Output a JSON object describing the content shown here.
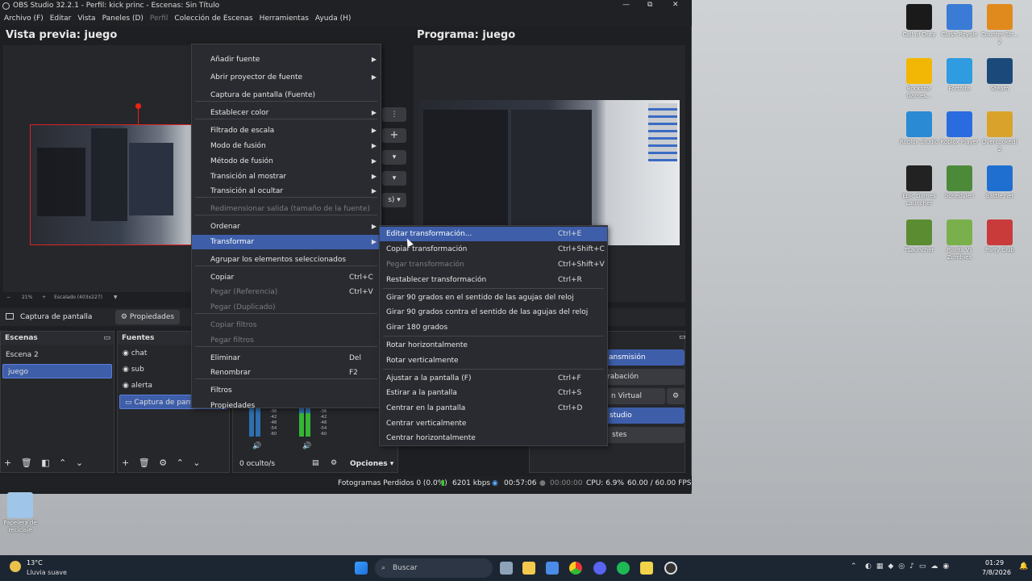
{
  "window": {
    "title": "OBS Studio 32.2.1 - Perfil: kick princ - Escenas: Sin Título",
    "minimize": "—",
    "maximize": "⧉",
    "close": "✕"
  },
  "menubar": [
    "Archivo (F)",
    "Editar",
    "Vista",
    "Paneles (D)",
    "Perfil",
    "Colección de Escenas",
    "Herramientas",
    "Ayuda (H)"
  ],
  "preview": {
    "title": "Vista previa: juego",
    "zoom": "21%",
    "scale": "Escalado (403x227)"
  },
  "program": {
    "title": "Programa: juego"
  },
  "source_toolbar": {
    "source": "Captura de pantalla",
    "properties": "Propiedades"
  },
  "scenes": {
    "title": "Escenas",
    "items": [
      "Escena 2",
      "juego"
    ]
  },
  "sources": {
    "title": "Fuentes",
    "items": [
      "chat",
      "sub",
      "alerta",
      "Captura de pantalla"
    ]
  },
  "mixer": {
    "hidden": "0 oculto/s",
    "options": "Opciones",
    "ticks": [
      "-36",
      "-42",
      "-48",
      "-54",
      "-60"
    ]
  },
  "controls": {
    "stream": "ansmisión",
    "record": "rabación",
    "virtual": "n Virtual",
    "studio": "studio",
    "settings": "stes"
  },
  "status": {
    "dropped": "Fotogramas Perdidos 0 (0.0%)",
    "kbps": "6201 kbps",
    "stream_time": "00:57:06",
    "rec_time": "00:00:00",
    "cpu": "CPU: 6.9%",
    "fps": "60.00 / 60.00 FPS"
  },
  "context_menu": [
    {
      "label": "Añadir fuente",
      "arrow": true
    },
    {
      "label": "Abrir proyector de fuente",
      "arrow": true
    },
    {
      "label": "Captura de pantalla (Fuente)"
    },
    {
      "label": "Establecer color",
      "arrow": true
    },
    {
      "label": "Filtrado de escala",
      "arrow": true
    },
    {
      "label": "Modo de fusión",
      "arrow": true
    },
    {
      "label": "Método de fusión",
      "arrow": true
    },
    {
      "label": "Transición al mostrar",
      "arrow": true
    },
    {
      "label": "Transición al ocultar",
      "arrow": true
    },
    {
      "label": "Redimensionar salida (tamaño de la fuente)",
      "disabled": true
    },
    {
      "label": "Ordenar",
      "arrow": true
    },
    {
      "label": "Transformar",
      "arrow": true,
      "highlight": true
    },
    {
      "label": "Agrupar los elementos seleccionados"
    },
    {
      "label": "Copiar",
      "shortcut": "Ctrl+C"
    },
    {
      "label": "Pegar (Referencia)",
      "shortcut": "Ctrl+V",
      "disabled": true
    },
    {
      "label": "Pegar (Duplicado)",
      "disabled": true
    },
    {
      "label": "Copiar filtros",
      "disabled": true
    },
    {
      "label": "Pegar filtros",
      "disabled": true
    },
    {
      "label": "Eliminar",
      "shortcut": "Del"
    },
    {
      "label": "Renombrar",
      "shortcut": "F2"
    },
    {
      "label": "Filtros"
    },
    {
      "label": "Propiedades"
    }
  ],
  "transform_menu": [
    {
      "label": "Editar transformación...",
      "shortcut": "Ctrl+E",
      "highlight": true
    },
    {
      "label": "Copiar transformación",
      "shortcut": "Ctrl+Shift+C"
    },
    {
      "label": "Pegar transformación",
      "shortcut": "Ctrl+Shift+V",
      "disabled": true
    },
    {
      "label": "Restablecer transformación",
      "shortcut": "Ctrl+R"
    },
    {
      "label": "Girar 90 grados en el sentido de las agujas del reloj"
    },
    {
      "label": "Girar 90 grados contra el sentido de las agujas del reloj"
    },
    {
      "label": "Girar 180 grados"
    },
    {
      "label": "Rotar horizontalmente"
    },
    {
      "label": "Rotar verticalmente"
    },
    {
      "label": "Ajustar a la pantalla (F)",
      "shortcut": "Ctrl+F"
    },
    {
      "label": "Estirar a la pantalla",
      "shortcut": "Ctrl+S"
    },
    {
      "label": "Centrar en la pantalla",
      "shortcut": "Ctrl+D"
    },
    {
      "label": "Centrar verticalmente"
    },
    {
      "label": "Centrar horizontalmente"
    }
  ],
  "desktop_icons": [
    {
      "label": "Call of Duty",
      "color": "#1a1a1a"
    },
    {
      "label": "Clash Royale",
      "color": "#3a7bd5"
    },
    {
      "label": "Counter-Str... 2",
      "color": "#e08a1e"
    },
    {
      "label": "Rockstar Games...",
      "color": "#f2b705"
    },
    {
      "label": "Fortnite",
      "color": "#2f9be0"
    },
    {
      "label": "Steam",
      "color": "#1b4a7a"
    },
    {
      "label": "Roblox Studio",
      "color": "#2a8ad4"
    },
    {
      "label": "Roblox Player",
      "color": "#2b6be0"
    },
    {
      "label": "Overcooked! 2",
      "color": "#d9a32b"
    },
    {
      "label": "Epic Games Launcher",
      "color": "#222222"
    },
    {
      "label": "Schedule I",
      "color": "#4c8a3a"
    },
    {
      "label": "Battle.net",
      "color": "#1f6fd1"
    },
    {
      "label": "TLauncher",
      "color": "#5b8c32"
    },
    {
      "label": "Plants Vs Zombies",
      "color": "#7ab04c"
    },
    {
      "label": "Party Club",
      "color": "#c93a3a"
    },
    {
      "label": "Papelera de reciclaje",
      "color": "#9fc6e8"
    }
  ],
  "taskbar": {
    "temp": "13°C",
    "weather": "Lluvia suave",
    "search": "Buscar",
    "time": "01:29",
    "date": "7/8/2026"
  }
}
